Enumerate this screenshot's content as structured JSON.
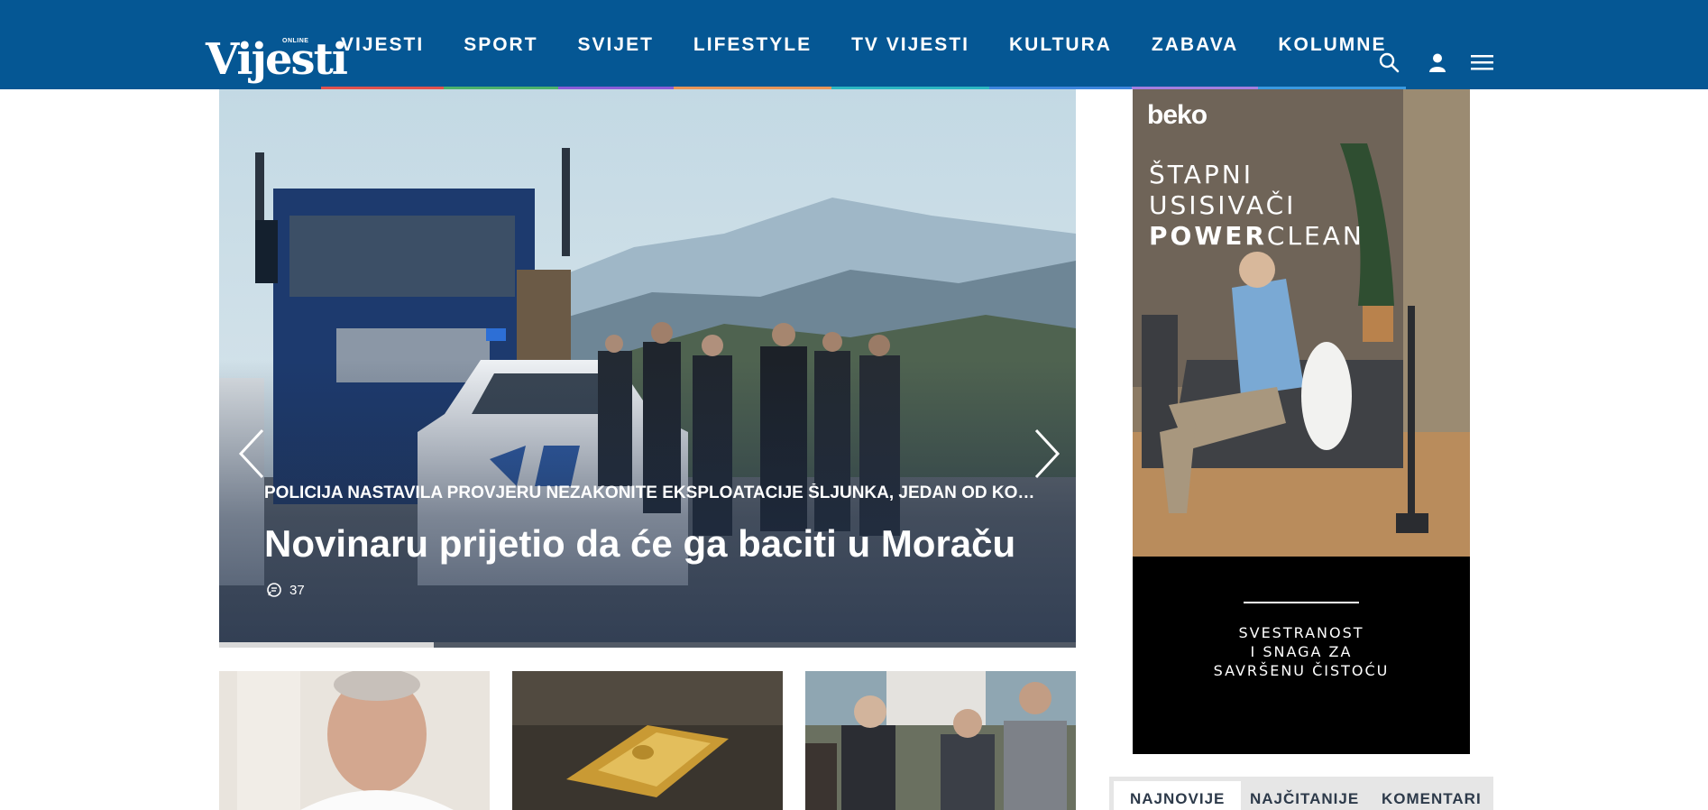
{
  "site": {
    "logo_text": "Vijesti",
    "logo_sub": "ONLINE"
  },
  "nav": {
    "items": [
      {
        "label": "VIJESTI",
        "bar_color": "#e0524f"
      },
      {
        "label": "SPORT",
        "bar_color": "#4cb26c"
      },
      {
        "label": "SVIJET",
        "bar_color": "#8a5cd8"
      },
      {
        "label": "LIFESTYLE",
        "bar_color": "#e8965a"
      },
      {
        "label": "TV VIJESTI",
        "bar_color": "#2cb7c3"
      },
      {
        "label": "KULTURA",
        "bar_color": "#3e86de"
      },
      {
        "label": "ZABAVA",
        "bar_color": "#a47ee0"
      },
      {
        "label": "KOLUMNE",
        "bar_color": "#3a9ae0"
      }
    ],
    "icons": [
      "search-icon",
      "user-icon",
      "menu-icon"
    ]
  },
  "hero": {
    "kicker": "POLICIJA NASTAVILA PROVJERU NEZAKONITE EKSPLOATACIJE ŠLJUNKA, JEDAN OD KONTROLI...",
    "title": "Novinaru prijetio da će ga baciti u Moraču",
    "comment_count": "37",
    "slide_progress": 0.25,
    "icons": [
      "chevron-left-icon",
      "chevron-right-icon",
      "comment-icon"
    ]
  },
  "thumbnails": [
    {
      "image": "man-portrait-photo"
    },
    {
      "image": "gold-bar-photo"
    },
    {
      "image": "crowd-street-photo"
    }
  ],
  "ad": {
    "brand": "beko",
    "headline_lines": [
      "ŠTAPNI",
      "USISIVAČI"
    ],
    "headline_bold": "POWER",
    "headline_rest": "CLEAN",
    "tagline_lines": [
      "SVESTRANOST",
      "I SNAGA ZA",
      "SAVRŠENU ČISTOĆU"
    ]
  },
  "sidebar_tabs": [
    {
      "label": "NAJNOVIJE",
      "active": true
    },
    {
      "label": "NAJČITANIJE",
      "active": false
    },
    {
      "label": "KOMENTARI",
      "active": false
    }
  ],
  "colors": {
    "header_bg": "#055794",
    "tabs_bg": "#e6e6e6"
  }
}
